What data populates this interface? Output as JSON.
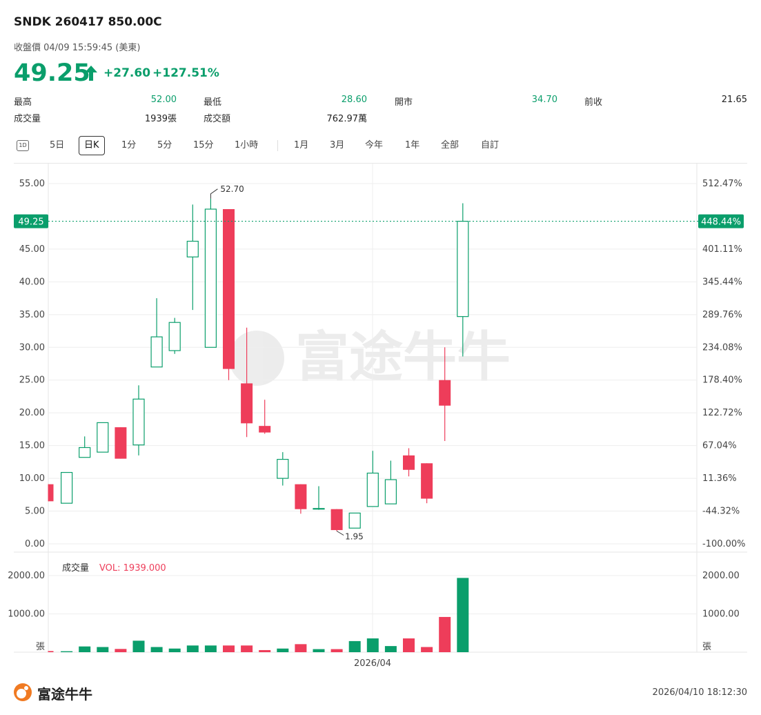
{
  "header": {
    "symbol": "SNDK 260417 850.00C",
    "status": "收盤價 04/09 15:59:45 (美東)",
    "price": "49.25",
    "change": "+27.60",
    "change_pct": "+127.51%"
  },
  "stats": {
    "high_label": "最高",
    "high": "52.00",
    "low_label": "最低",
    "low": "28.60",
    "open_label": "開市",
    "open": "34.70",
    "prev_label": "前收",
    "prev": "21.65",
    "vol_label": "成交量",
    "vol": "1939張",
    "amount_label": "成交額",
    "amount": "762.97萬"
  },
  "toolbar": {
    "icon": "1D",
    "items": [
      "5日",
      "日K",
      "1分",
      "5分",
      "15分",
      "1小時",
      "1月",
      "3月",
      "今年",
      "1年",
      "全部",
      "自訂"
    ],
    "active": "日K"
  },
  "colors": {
    "up": "#0a9e6b",
    "down": "#ee3d5a",
    "grid": "#eeeeee",
    "text": "#444444"
  },
  "chart_data": {
    "type": "candlestick",
    "y_ticks": [
      "55.00",
      "45.00",
      "40.00",
      "35.00",
      "30.00",
      "25.00",
      "20.00",
      "15.00",
      "10.00",
      "5.00",
      "0.00"
    ],
    "pct_ticks": [
      "512.47%",
      "401.11%",
      "345.44%",
      "289.76%",
      "234.08%",
      "178.40%",
      "122.72%",
      "67.04%",
      "11.36%",
      "-44.32%",
      "-100.00%"
    ],
    "ylim": [
      0,
      55
    ],
    "last_price_label": "49.25",
    "last_pct_label": "448.44%",
    "last_price": 49.25,
    "high_marker": "52.70",
    "low_marker": "1.95",
    "x_label": "2026/04",
    "candles": [
      {
        "o": 9.1,
        "h": 9.1,
        "l": 6.5,
        "c": 6.5,
        "v": 30
      },
      {
        "o": 6.2,
        "h": 10.9,
        "l": 6.2,
        "c": 10.9,
        "v": 25
      },
      {
        "o": 13.2,
        "h": 16.4,
        "l": 13.2,
        "c": 14.7,
        "v": 150
      },
      {
        "o": 14.0,
        "h": 18.5,
        "l": 14.0,
        "c": 18.5,
        "v": 135
      },
      {
        "o": 17.8,
        "h": 17.8,
        "l": 13.0,
        "c": 13.0,
        "v": 85
      },
      {
        "o": 15.1,
        "h": 24.2,
        "l": 13.5,
        "c": 22.1,
        "v": 300
      },
      {
        "o": 27.0,
        "h": 37.5,
        "l": 27.0,
        "c": 31.6,
        "v": 135
      },
      {
        "o": 29.5,
        "h": 34.5,
        "l": 29.0,
        "c": 33.8,
        "v": 95
      },
      {
        "o": 43.8,
        "h": 51.8,
        "l": 35.7,
        "c": 46.2,
        "v": 175
      },
      {
        "o": 30.0,
        "h": 52.7,
        "l": 30.0,
        "c": 51.1,
        "v": 175
      },
      {
        "o": 51.1,
        "h": 51.1,
        "l": 25.0,
        "c": 26.7,
        "v": 175
      },
      {
        "o": 24.5,
        "h": 33.0,
        "l": 16.3,
        "c": 18.4,
        "v": 175
      },
      {
        "o": 18.0,
        "h": 22.0,
        "l": 16.8,
        "c": 17.0,
        "v": 55
      },
      {
        "o": 10.0,
        "h": 14.0,
        "l": 8.9,
        "c": 12.9,
        "v": 95
      },
      {
        "o": 9.1,
        "h": 9.1,
        "l": 4.6,
        "c": 5.3,
        "v": 210
      },
      {
        "o": 5.3,
        "h": 8.8,
        "l": 5.2,
        "c": 5.4,
        "v": 80
      },
      {
        "o": 5.3,
        "h": 5.3,
        "l": 1.95,
        "c": 2.1,
        "v": 80
      },
      {
        "o": 2.4,
        "h": 4.7,
        "l": 2.4,
        "c": 4.7,
        "v": 290
      },
      {
        "o": 5.7,
        "h": 14.2,
        "l": 5.7,
        "c": 10.8,
        "v": 360
      },
      {
        "o": 6.1,
        "h": 12.7,
        "l": 6.1,
        "c": 9.8,
        "v": 160
      },
      {
        "o": 13.5,
        "h": 14.6,
        "l": 10.3,
        "c": 11.3,
        "v": 360
      },
      {
        "o": 12.3,
        "h": 12.3,
        "l": 6.2,
        "c": 6.9,
        "v": 135
      },
      {
        "o": 25.0,
        "h": 30.0,
        "l": 15.7,
        "c": 21.1,
        "v": 920
      },
      {
        "o": 34.7,
        "h": 52.0,
        "l": 28.6,
        "c": 49.25,
        "v": 1939
      }
    ],
    "volume_label": "成交量",
    "volume_value_label": "VOL: 1939.000",
    "vol_ticks": [
      "2000.00",
      "1000.00"
    ],
    "vol_unit": "張",
    "vol_ylim": [
      0,
      2000
    ]
  },
  "footer": {
    "brand": "富途牛牛",
    "watermark": "富途牛牛",
    "timestamp": "2026/04/10 18:12:30"
  }
}
